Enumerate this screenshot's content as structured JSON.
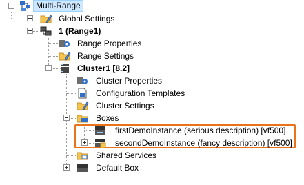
{
  "tree": {
    "root": {
      "label": "Multi-Range",
      "icon": "multi-range-icon"
    },
    "global_settings": {
      "label": "Global Settings",
      "icon": "settings-folder-icon"
    },
    "range1": {
      "label": "1 (Range1)",
      "icon": "range-icon",
      "properties": {
        "label": "Range Properties",
        "icon": "properties-gear-icon"
      },
      "settings": {
        "label": "Range Settings",
        "icon": "settings-folder-icon"
      },
      "cluster1": {
        "label": "Cluster1 [8.2]",
        "icon": "cluster-icon",
        "properties": {
          "label": "Cluster Properties",
          "icon": "properties-gear-icon"
        },
        "config_templates": {
          "label": "Configuration Templates",
          "icon": "template-document-icon"
        },
        "settings": {
          "label": "Cluster Settings",
          "icon": "settings-folder-icon"
        },
        "boxes": {
          "label": "Boxes",
          "icon": "boxes-folder-icon",
          "instances": [
            {
              "label": "firstDemoInstance (serious description) [vf500]",
              "icon": "box-instance-icon"
            },
            {
              "label": "secondDemoInstance (fancy description) [vf500]",
              "icon": "box-instance-locked-icon"
            }
          ]
        },
        "shared_services": {
          "label": "Shared Services",
          "icon": "shared-services-folder-icon"
        },
        "default_box": {
          "label": "Default Box",
          "icon": "default-box-icon"
        }
      }
    }
  },
  "colors": {
    "highlight_border": "#e8731a",
    "selection_bg": "#cde8ff",
    "folder": "#f6c34d",
    "connector": "#9a9a9a"
  }
}
